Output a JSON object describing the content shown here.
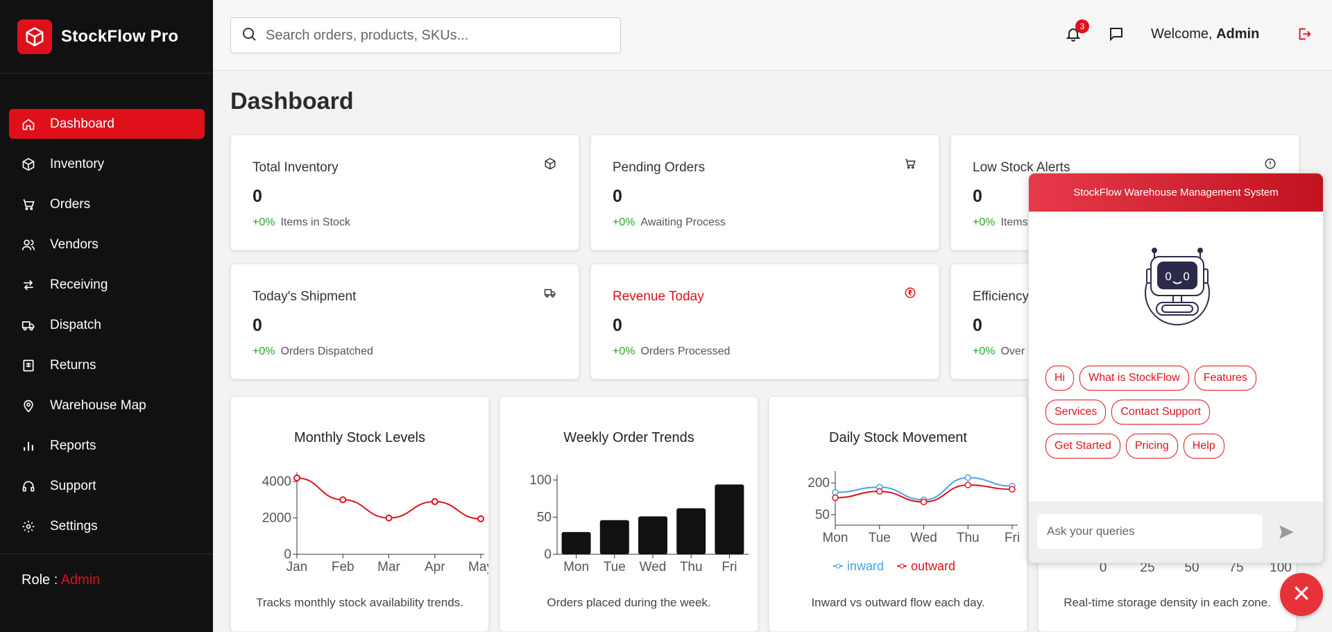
{
  "app": {
    "name": "StockFlow Pro"
  },
  "sidebar": {
    "items": [
      {
        "label": "Dashboard",
        "icon": "home-icon",
        "active": true
      },
      {
        "label": "Inventory",
        "icon": "box-icon"
      },
      {
        "label": "Orders",
        "icon": "cart-icon"
      },
      {
        "label": "Vendors",
        "icon": "users-icon"
      },
      {
        "label": "Receiving",
        "icon": "arrows-icon"
      },
      {
        "label": "Dispatch",
        "icon": "truck-icon"
      },
      {
        "label": "Returns",
        "icon": "receipt-icon"
      },
      {
        "label": "Warehouse Map",
        "icon": "map-pin-icon"
      },
      {
        "label": "Reports",
        "icon": "bar-chart-icon"
      },
      {
        "label": "Support",
        "icon": "headset-icon"
      },
      {
        "label": "Settings",
        "icon": "gear-icon"
      }
    ],
    "role_label": "Role :",
    "role_value": "Admin"
  },
  "topbar": {
    "search_placeholder": "Search orders, products, SKUs...",
    "notification_count": "3",
    "welcome_prefix": "Welcome,",
    "welcome_user": "Admin"
  },
  "page": {
    "title": "Dashboard"
  },
  "stats": [
    {
      "title": "Total Inventory",
      "value": "0",
      "change": "+0%",
      "sub": "Items in Stock",
      "icon": "box-icon"
    },
    {
      "title": "Pending Orders",
      "value": "0",
      "change": "+0%",
      "sub": "Awaiting Process",
      "icon": "cart-icon"
    },
    {
      "title": "Low Stock Alerts",
      "value": "0",
      "change": "+0%",
      "sub": "Items",
      "icon": "alert-circle-icon"
    },
    {
      "title": "Today's Shipment",
      "value": "0",
      "change": "+0%",
      "sub": "Orders Dispatched",
      "icon": "truck-icon"
    },
    {
      "title": "Revenue Today",
      "value": "0",
      "change": "+0%",
      "sub": "Orders Processed",
      "icon": "rupee-icon"
    },
    {
      "title": "Efficiency",
      "value": "0",
      "change": "+0%",
      "sub": "Over",
      "icon": ""
    }
  ],
  "charts": {
    "monthly": {
      "title": "Monthly Stock Levels",
      "desc": "Tracks monthly stock availability trends."
    },
    "weekly": {
      "title": "Weekly Order Trends",
      "desc": "Orders placed during the week."
    },
    "daily": {
      "title": "Daily Stock Movement",
      "desc": "Inward vs outward flow each day."
    },
    "density": {
      "desc": "Real-time storage density in each zone."
    }
  },
  "chart_data": [
    {
      "type": "line",
      "title": "Monthly Stock Levels",
      "x": [
        "Jan",
        "Feb",
        "Mar",
        "Apr",
        "May"
      ],
      "series": [
        {
          "values": [
            4200,
            3000,
            2000,
            2900,
            1950
          ]
        }
      ],
      "yticks": [
        0,
        2000,
        4000
      ],
      "ylim": [
        0,
        4200
      ],
      "color": "#e0101a"
    },
    {
      "type": "bar",
      "title": "Weekly Order Trends",
      "categories": [
        "Mon",
        "Tue",
        "Wed",
        "Thu",
        "Fri"
      ],
      "values": [
        30,
        46,
        51,
        62,
        94
      ],
      "yticks": [
        0,
        50,
        100
      ],
      "ylim": [
        0,
        100
      ],
      "color": "#111111"
    },
    {
      "type": "line",
      "title": "Daily Stock Movement",
      "x": [
        "Mon",
        "Tue",
        "Wed",
        "Thu",
        "Fri"
      ],
      "series": [
        {
          "name": "inward",
          "values": [
            155,
            180,
            120,
            225,
            185
          ],
          "color": "#4aa3df"
        },
        {
          "name": "outward",
          "values": [
            130,
            160,
            110,
            190,
            170
          ],
          "color": "#e0101a"
        }
      ],
      "yticks": [
        50,
        200
      ],
      "ylim": [
        0,
        230
      ]
    },
    {
      "type": "bar",
      "xticks": [
        "0",
        "25",
        "50",
        "75",
        "100"
      ]
    }
  ],
  "chat": {
    "header": "StockFlow Warehouse Management System",
    "chips": [
      "Hi",
      "What is StockFlow",
      "Features",
      "Services",
      "Contact Support",
      "Get Started",
      "Pricing",
      "Help"
    ],
    "input_placeholder": "Ask your queries"
  }
}
